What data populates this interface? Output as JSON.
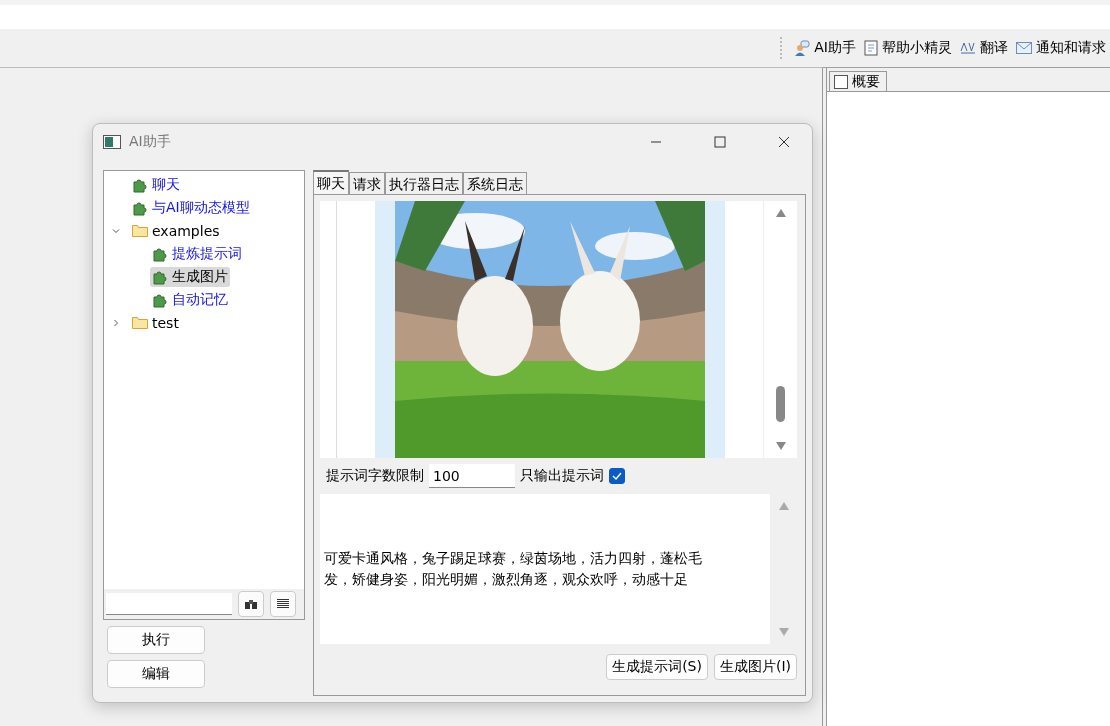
{
  "toolbar": {
    "items": [
      {
        "label": "AI助手",
        "kind": "assistant"
      },
      {
        "label": "帮助小精灵",
        "kind": "notebook"
      },
      {
        "label": "翻译",
        "kind": "translate"
      },
      {
        "label": "通知和请求",
        "kind": "mail"
      }
    ]
  },
  "right_panel": {
    "tab": {
      "label": "概要",
      "checked": false
    }
  },
  "dialog": {
    "title": "AI助手",
    "tree": [
      {
        "label": "聊天",
        "kind": "script",
        "selected": false
      },
      {
        "label": "与AI聊动态模型",
        "kind": "script",
        "selected": false
      },
      {
        "label": "examples",
        "kind": "folder",
        "expanded": true,
        "selected": false,
        "children": [
          {
            "label": "提炼提示词",
            "kind": "script",
            "selected": false
          },
          {
            "label": "生成图片",
            "kind": "script",
            "selected": true
          },
          {
            "label": "自动记忆",
            "kind": "script",
            "selected": false
          }
        ]
      },
      {
        "label": "test",
        "kind": "folder",
        "expanded": false,
        "selected": false
      }
    ],
    "buttons": [
      "执行",
      "编辑"
    ],
    "tabs": [
      {
        "label": "聊天",
        "selected": true
      },
      {
        "label": "请求",
        "selected": false
      },
      {
        "label": "执行器日志",
        "selected": false
      },
      {
        "label": "系统日志",
        "selected": false
      }
    ],
    "image": {
      "kind": "picture"
    },
    "limit_label": "提示词字数限制",
    "limit_value": "100",
    "only_prompt": {
      "label": "只输出提示词",
      "checked": true
    },
    "prompt_text": "可爱卡通风格，兔子踢足球赛，绿茵场地，活力四射，蓬松毛发，矫健身姿，阳光明媚，激烈角逐，观众欢呼，动感十足",
    "actions": [
      "生成提示词(S)",
      "生成图片(I)"
    ]
  }
}
